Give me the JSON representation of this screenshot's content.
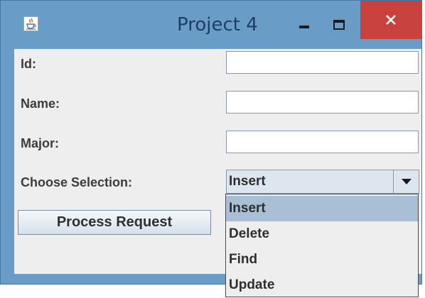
{
  "window": {
    "title": "Project 4",
    "minimize_symbol": "–",
    "close_symbol": "✕"
  },
  "form": {
    "id_label": "Id:",
    "id_value": "",
    "name_label": "Name:",
    "name_value": "",
    "major_label": "Major:",
    "major_value": "",
    "selection_label": "Choose Selection:",
    "selection_value": "Insert",
    "process_button": "Process Request"
  },
  "dropdown": {
    "options": [
      "Insert",
      "Delete",
      "Find",
      "Update"
    ],
    "selected": "Insert"
  },
  "colors": {
    "window_frame": "#6a9cc8",
    "close_button": "#c9413e",
    "selected_item": "#a9bfd6",
    "panel_background": "#eeeeee"
  },
  "icons": {
    "app": "java-coffee-cup-icon",
    "minimize": "minimize-icon",
    "maximize": "maximize-icon",
    "close": "close-icon",
    "dropdown_arrow": "triangle-down-icon"
  }
}
